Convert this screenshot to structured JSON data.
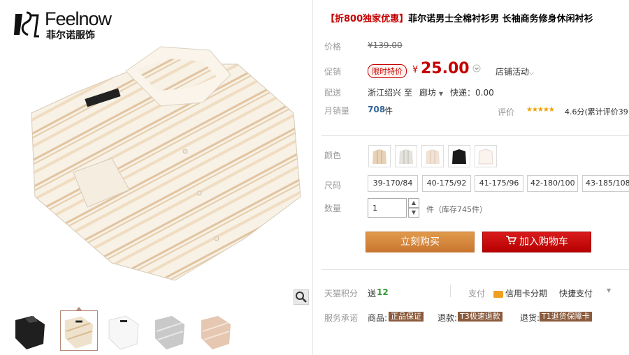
{
  "brand": {
    "name": "Feelnow",
    "sub": "菲尔诺服饰"
  },
  "product": {
    "title_highlight": "【折800独家优惠】",
    "title_rest": "菲尔诺男士全棉衬衫男 长袖商务修身休闲衬衫"
  },
  "price": {
    "label": "价格",
    "original": "¥139.00"
  },
  "promo": {
    "label": "促销",
    "badge": "限时特价",
    "currency": "¥",
    "price": "25.00",
    "store_promo": "店铺活动"
  },
  "shipping": {
    "label": "配送",
    "from": "浙江绍兴",
    "to_word": "至",
    "to": "廊坊",
    "express": "快递：0.00"
  },
  "sales": {
    "label": "月销量",
    "count": "708",
    "unit": "件",
    "rating_label": "评价",
    "rating_text": "4.6分(累计评价39"
  },
  "color": {
    "label": "颜色",
    "swatches": [
      "khaki-stripe",
      "grey-stripe",
      "beige-stripe",
      "black",
      "white"
    ]
  },
  "size": {
    "label": "尺码",
    "options": [
      "39-170/84",
      "40-175/92",
      "41-175/96",
      "42-180/100",
      "43-185/108"
    ]
  },
  "quantity": {
    "label": "数量",
    "value": "1",
    "unit_text": "件（库存745件）"
  },
  "buttons": {
    "buy": "立刻购买",
    "cart": "加入购物车"
  },
  "points": {
    "label": "天猫积分",
    "prefix": "送",
    "value": "12"
  },
  "payment": {
    "label": "支付",
    "card": "信用卡分期",
    "express": "快捷支付"
  },
  "service": {
    "label": "服务承诺",
    "goods_label": "商品:",
    "goods_tag": "正品保证",
    "refund_label": "退款:",
    "refund_tag": "T3极速退款",
    "return_label": "退货:",
    "return_tag": "T1退货保障卡"
  },
  "icons": [
    "zoom-icon",
    "cart-icon",
    "credit-card-icon",
    "chevron-down-icon"
  ],
  "colors": {
    "accent": "#c40000",
    "buy": "#d88f40",
    "cart": "#c40000"
  }
}
